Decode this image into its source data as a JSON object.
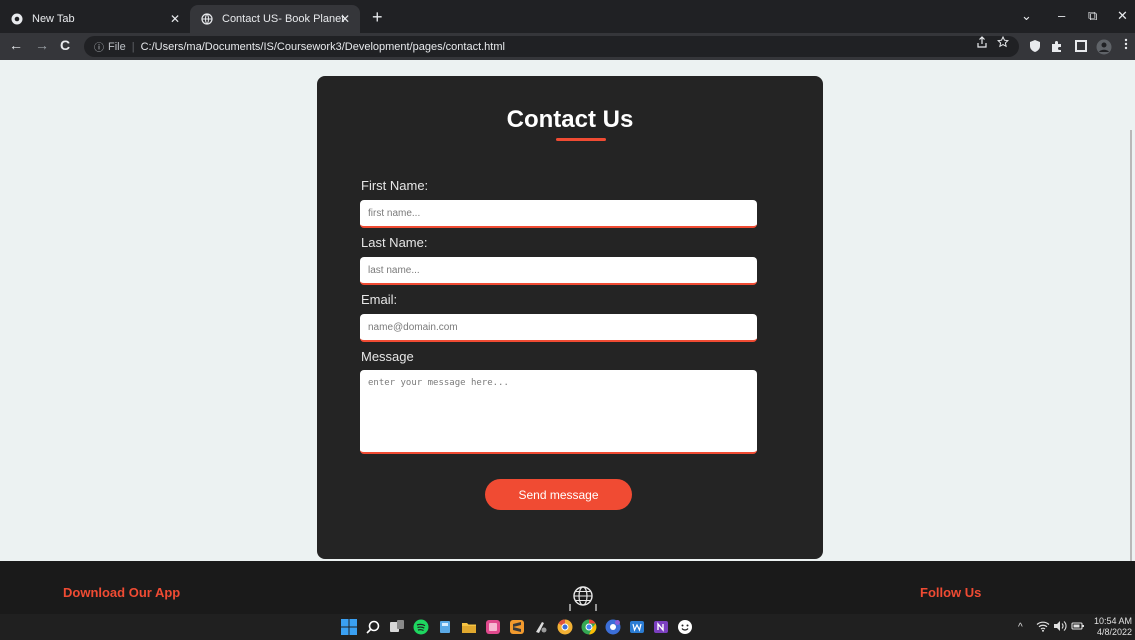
{
  "browser": {
    "tabs": [
      {
        "title": "New Tab",
        "icon": "chrome-icon",
        "active": false
      },
      {
        "title": "Contact US- Book Planet",
        "icon": "globe-favicon-icon",
        "active": true
      }
    ],
    "new_tab": "+",
    "close_glyph": "✕",
    "address": {
      "info_glyph": "ⓘ",
      "scheme_label": "File",
      "separator": "|",
      "url": "C:/Users/ma/Documents/IS/Coursework3/Development/pages/contact.html"
    },
    "nav": {
      "back": "←",
      "forward": "→",
      "reload": "C"
    },
    "window_controls": {
      "collapse": "⌄",
      "minimize": "–",
      "restore": "⧉",
      "close": "✕"
    }
  },
  "page": {
    "contact": {
      "title": "Contact Us",
      "fields": {
        "first_name": {
          "label": "First Name:",
          "placeholder": "first name..."
        },
        "last_name": {
          "label": "Last Name:",
          "placeholder": "last name..."
        },
        "email": {
          "label": "Email:",
          "placeholder": "name@domain.com"
        },
        "message": {
          "label": "Message",
          "placeholder": "enter your message here..."
        }
      },
      "submit_label": "Send message"
    },
    "footer": {
      "download_app": "Download Our App",
      "follow_us": "Follow Us",
      "center_icon": "globe-icon"
    }
  },
  "taskbar": {
    "apps": [
      "windows-start-icon",
      "search-icon",
      "task-view-icon",
      "spotify-icon",
      "files-icon",
      "file-explorer-icon",
      "app-icon",
      "sublime-icon",
      "app-icon",
      "chrome-canary-icon",
      "chrome-icon",
      "chrome-beta-icon",
      "word-icon",
      "onenote-icon",
      "emoji-icon"
    ],
    "tray": {
      "chevron": "^"
    },
    "time": "10:54 AM",
    "date": "4/8/2022"
  },
  "colors": {
    "accent": "#f04b33",
    "card": "#242424",
    "page_bg": "#ecf2f2",
    "footer_bg": "#1a1a1a"
  }
}
